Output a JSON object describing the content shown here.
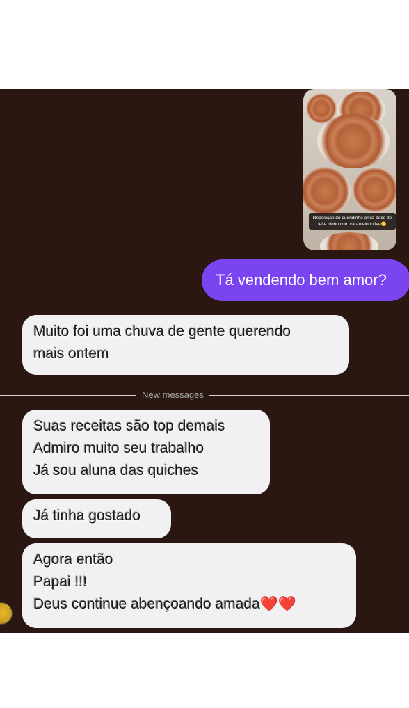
{
  "story_reply": {
    "caption": "Reposição do queridinho arroz doce de leite ninho com caramelo toffee😋"
  },
  "messages": {
    "outgoing_1": "Tá vendendo bem amor?",
    "incoming_1": [
      "Muito foi uma chuva de gente querendo",
      "mais ontem"
    ],
    "divider": "New messages",
    "incoming_2": [
      "Suas receitas são top demais",
      "Admiro muito seu trabalho",
      "Já sou aluna das quiches"
    ],
    "incoming_3": "Já tinha gostado",
    "incoming_4": [
      "Agora então",
      "Papai !!!",
      "Deus continue abençoando amada"
    ],
    "hearts": "❤️❤️"
  },
  "colors": {
    "chat_background": "#2a1712",
    "outgoing_bubble": "#7a45f0",
    "incoming_bubble": "#f1f1f3"
  }
}
